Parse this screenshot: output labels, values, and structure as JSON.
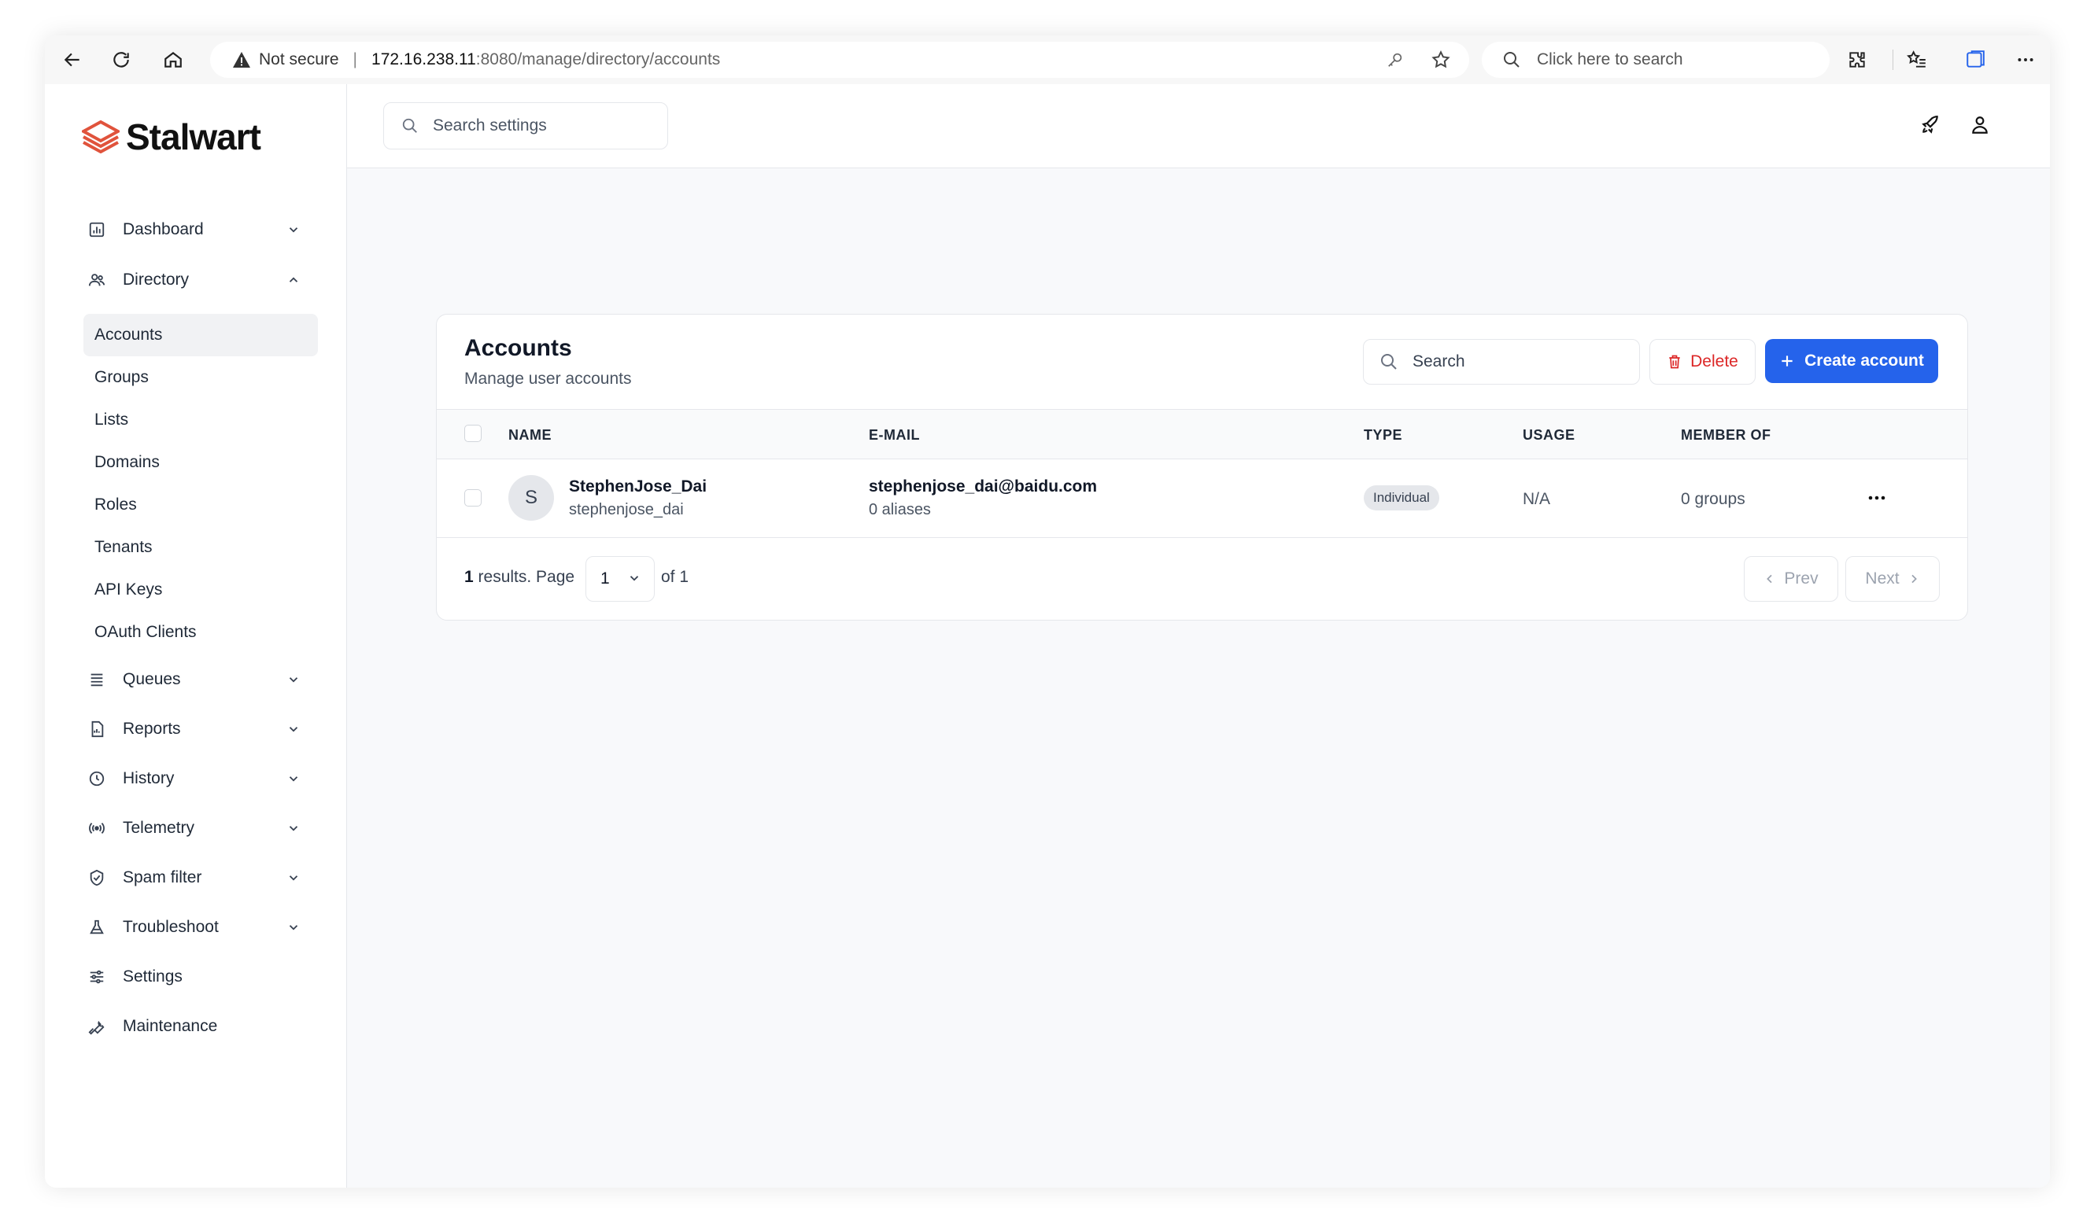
{
  "browser": {
    "security_label": "Not secure",
    "url_host": "172.16.238.11",
    "url_path": ":8080/manage/directory/accounts",
    "search_placeholder": "Click here to search"
  },
  "app": {
    "logo_text": "Stalwart",
    "settings_search_placeholder": "Search settings",
    "brand_color": "#e0533c",
    "accent_color": "#2563eb"
  },
  "sidebar": {
    "items": [
      {
        "label": "Dashboard",
        "icon": "dashboard-icon",
        "expandable": true
      },
      {
        "label": "Directory",
        "icon": "directory-icon",
        "expandable": true,
        "expanded": true
      },
      {
        "label": "Queues",
        "icon": "queues-icon",
        "expandable": true
      },
      {
        "label": "Reports",
        "icon": "reports-icon",
        "expandable": true
      },
      {
        "label": "History",
        "icon": "history-icon",
        "expandable": true
      },
      {
        "label": "Telemetry",
        "icon": "telemetry-icon",
        "expandable": true
      },
      {
        "label": "Spam filter",
        "icon": "spam-filter-icon",
        "expandable": true
      },
      {
        "label": "Troubleshoot",
        "icon": "troubleshoot-icon",
        "expandable": true
      },
      {
        "label": "Settings",
        "icon": "settings-icon",
        "expandable": false
      },
      {
        "label": "Maintenance",
        "icon": "maintenance-icon",
        "expandable": false
      }
    ],
    "directory_sub": [
      {
        "label": "Accounts",
        "active": true
      },
      {
        "label": "Groups"
      },
      {
        "label": "Lists"
      },
      {
        "label": "Domains"
      },
      {
        "label": "Roles"
      },
      {
        "label": "Tenants"
      },
      {
        "label": "API Keys"
      },
      {
        "label": "OAuth Clients"
      }
    ]
  },
  "accounts": {
    "title": "Accounts",
    "subtitle": "Manage user accounts",
    "search_placeholder": "Search",
    "delete_label": "Delete",
    "create_label": "Create account",
    "columns": [
      "NAME",
      "E-MAIL",
      "TYPE",
      "USAGE",
      "MEMBER OF"
    ],
    "rows": [
      {
        "avatar": "S",
        "name": "StephenJose_Dai",
        "username": "stephenjose_dai",
        "email": "stephenjose_dai@baidu.com",
        "aliases": "0 aliases",
        "type": "Individual",
        "usage": "N/A",
        "member_of": "0 groups"
      }
    ],
    "pagination": {
      "count": "1",
      "results_text": " results. Page",
      "page": "1",
      "of_text": "of 1",
      "prev_label": "Prev",
      "next_label": "Next"
    }
  }
}
